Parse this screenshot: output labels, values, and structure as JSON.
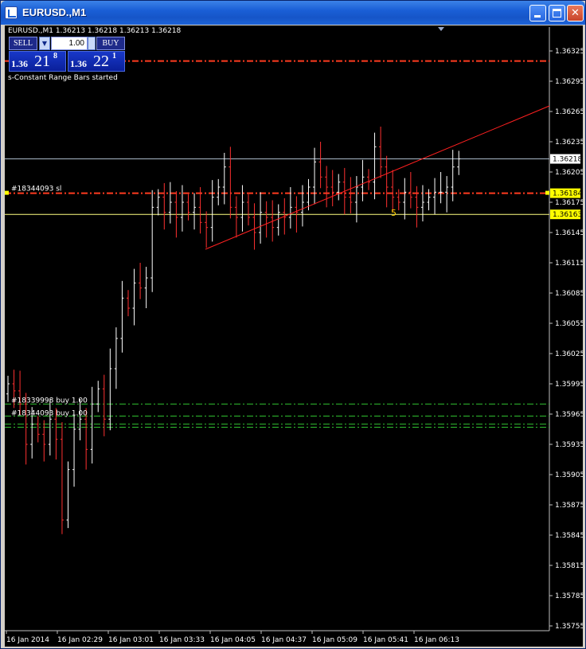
{
  "window": {
    "title": "EURUSD.,M1",
    "title_color": "#1a5fd6"
  },
  "chart": {
    "symbol_info": "EURUSD.,M1  1.36213 1.36218 1.36213 1.36218",
    "ea_message": "s-Constant Range Bars started",
    "one_click": {
      "sell_label": "SELL",
      "buy_label": "BUY",
      "lot": "1.00",
      "sell_big": "1.36",
      "sell_pips": "21",
      "sell_point": "8",
      "buy_big": "1.36",
      "buy_pips": "22",
      "buy_point": "1"
    },
    "price_axis_labels": [
      "1.36325",
      "1.36295",
      "1.36265",
      "1.36235",
      "1.36205",
      "1.36175",
      "1.36145",
      "1.36115",
      "1.36085",
      "1.36055",
      "1.36025",
      "1.35995",
      "1.35965",
      "1.35935",
      "1.35905",
      "1.35875",
      "1.35845",
      "1.35815",
      "1.35785",
      "1.35755"
    ],
    "highlighted_prices": [
      "1.36218",
      "1.36184",
      "1.36163"
    ],
    "time_labels": [
      "16 Jan 2014",
      "16 Jan 02:29",
      "16 Jan 03:01",
      "16 Jan 03:33",
      "16 Jan 04:05",
      "16 Jan 04:37",
      "16 Jan 05:09",
      "16 Jan 05:41",
      "16 Jan 06:13"
    ],
    "order_labels": {
      "sl": "#18344093 sl",
      "buy1": "#18339998 buy 1.00",
      "buy2": "#18344093 buy 1.00"
    },
    "annotation_5": "5",
    "colors": {
      "background": "#000000",
      "bull": "#ffffff",
      "bear": "#ff3030",
      "stop_line": "#ff3b1f",
      "buy_line": "#30c030",
      "trendline": "#ff2020",
      "bid_line": "#a9b8c8",
      "ask_line": "#ffff80"
    }
  },
  "chart_data": {
    "type": "candlestick",
    "symbol": "EURUSD.",
    "timeframe": "M1",
    "ylim": [
      1.35755,
      1.36325
    ],
    "prices": {
      "bid": 1.36218,
      "sl_line": 1.36184,
      "yellow_line": 1.36163,
      "top_stop_line": 1.36315,
      "buy_lines": [
        1.35975,
        1.35963,
        1.35955,
        1.35952
      ]
    },
    "series_close": [
      1.35995,
      1.35988,
      1.35975,
      1.35935,
      1.35955,
      1.35945,
      1.35935,
      1.3596,
      1.3594,
      1.3586,
      1.3591,
      1.3595,
      1.3596,
      1.3593,
      1.35975,
      1.3599,
      1.3596,
      1.3601,
      1.3604,
      1.3608,
      1.3607,
      1.36095,
      1.3609,
      1.361,
      1.3617,
      1.3618,
      1.36165,
      1.36175,
      1.3616,
      1.36175,
      1.36165,
      1.3617,
      1.36155,
      1.3615,
      1.3618,
      1.3619,
      1.3621,
      1.3617,
      1.3616,
      1.36175,
      1.3616,
      1.36145,
      1.36165,
      1.3616,
      1.3615,
      1.36165,
      1.3616,
      1.3617,
      1.36165,
      1.36175,
      1.3619,
      1.36215,
      1.362,
      1.3619,
      1.36185,
      1.36195,
      1.3618,
      1.36175,
      1.3619,
      1.362,
      1.36195,
      1.3623,
      1.3621,
      1.3619,
      1.3618,
      1.36175,
      1.36185,
      1.3618,
      1.3617,
      1.36175,
      1.3618,
      1.36185,
      1.36185,
      1.3619,
      1.3621,
      1.36218
    ]
  }
}
